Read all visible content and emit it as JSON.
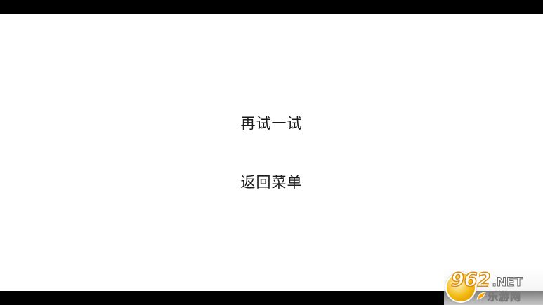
{
  "menu": {
    "retry_label": "再试一试",
    "back_label": "返回菜单"
  },
  "watermark": {
    "digits": "962",
    "suffix": ".NET",
    "site_name": "乐游网"
  },
  "colors": {
    "letterbox": "#000000",
    "background": "#ffffff",
    "text": "#1a1a1a",
    "logo_orange": "#f2b90f"
  }
}
